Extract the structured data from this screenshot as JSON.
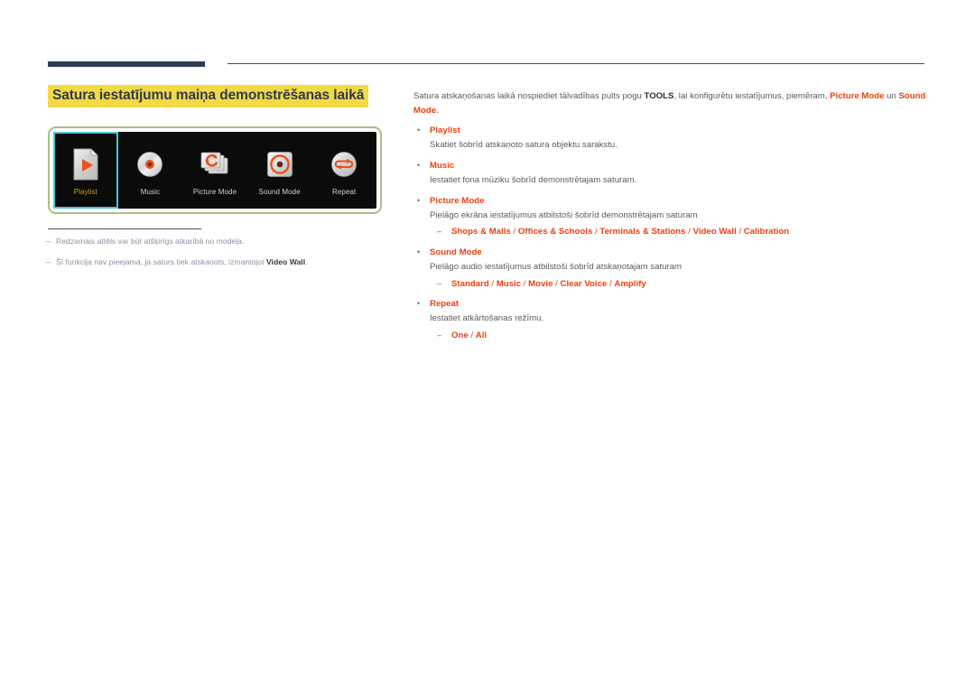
{
  "heading": "Satura iestatījumu maiņa demonstrēšanas laikā",
  "device_panel": {
    "items": [
      {
        "label": "Playlist",
        "icon": "playlist-page-play-icon",
        "selected": true
      },
      {
        "label": "Music",
        "icon": "music-disc-icon",
        "selected": false
      },
      {
        "label": "Picture Mode",
        "icon": "picture-mode-refresh-panels-icon",
        "selected": false
      },
      {
        "label": "Sound Mode",
        "icon": "sound-mode-speaker-icon",
        "selected": false
      },
      {
        "label": "Repeat",
        "icon": "repeat-loop-icon",
        "selected": false
      }
    ]
  },
  "footnotes": [
    {
      "dash": "–",
      "text_before": "Redzamais attēls var būt atšķirīgs atkarībā no modeļa.",
      "bold": "",
      "text_after": ""
    },
    {
      "dash": "–",
      "text_before": "Šī funkcija nav pieejama, ja saturs tiek atskaņots, izmantojot ",
      "bold": "Video Wall",
      "text_after": "."
    }
  ],
  "intro": {
    "part1": "Satura atskaņošanas laikā nospiediet tālvadības pults pogu ",
    "tools": "TOOLS",
    "part2": ", lai konfigurētu iestatījumus, piemēram, ",
    "picture_mode": "Picture Mode",
    "part3": " un ",
    "sound_mode": "Sound Mode",
    "part4": "."
  },
  "bullet_marker": "•",
  "sub_marker": "–",
  "bullets": [
    {
      "title": "Playlist",
      "desc": "Skatiet šobrīd atskaņoto satura objektu sarakstu.",
      "options": []
    },
    {
      "title": "Music",
      "desc": "Iestatiet fona mūziku šobrīd demonstrētajam saturam.",
      "options": []
    },
    {
      "title": "Picture Mode",
      "desc": "Pielāgo ekrāna iestatījumus atbilstoši šobrīd demonstrētajam saturam",
      "options": [
        "Shops & Malls",
        "Offices & Schools",
        "Terminals & Stations",
        "Video Wall",
        "Calibration"
      ]
    },
    {
      "title": "Sound Mode",
      "desc": "Pielāgo audio iestatījumus atbilstoši šobrīd atskaņotajam saturam",
      "options": [
        "Standard",
        "Music",
        "Movie",
        "Clear Voice",
        "Amplify"
      ]
    },
    {
      "title": "Repeat",
      "desc": "Iestatiet atkārtošanas režīmu.",
      "options": [
        "One",
        "All"
      ]
    }
  ],
  "colors": {
    "accent_red": "#e8400f",
    "heading_navy": "#2e3a56",
    "highlight_yellow": "#f2da44",
    "panel_border_green": "#a8c089",
    "selection_cyan": "#4fc4d6",
    "selected_label_gold": "#c9a227"
  }
}
